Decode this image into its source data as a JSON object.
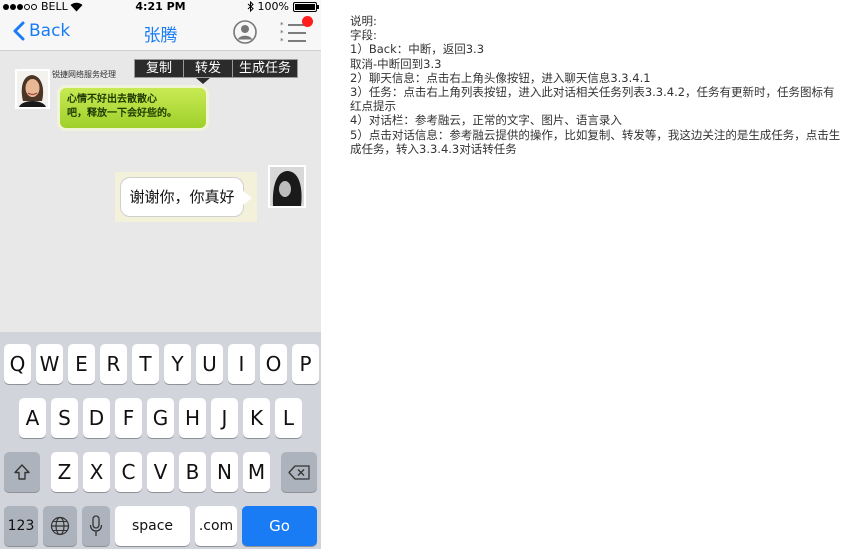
{
  "status_bar": {
    "carrier": "BELL",
    "time": "4:21 PM",
    "battery": "100%",
    "battery_level": 1.0
  },
  "nav": {
    "back_label": "Back",
    "title": "张腾",
    "tasks_has_update": true
  },
  "chat": {
    "context_menu": [
      "复制",
      "转发",
      "生成任务"
    ],
    "messages": [
      {
        "side": "left",
        "sender": "锐捷网络服务经理",
        "text_lines": [
          "心情不好出去散散心",
          "吧，释放一下会好些的。"
        ]
      },
      {
        "side": "right",
        "text": "谢谢你，你真好"
      }
    ]
  },
  "keyboard": {
    "row1": [
      "Q",
      "W",
      "E",
      "R",
      "T",
      "Y",
      "U",
      "I",
      "O",
      "P"
    ],
    "row2": [
      "A",
      "S",
      "D",
      "F",
      "G",
      "H",
      "J",
      "K",
      "L"
    ],
    "row3": [
      "Z",
      "X",
      "C",
      "V",
      "B",
      "N",
      "M"
    ],
    "numbers_key": "123",
    "space_key": "space",
    "dotcom_key": ".com",
    "go_key": "Go"
  },
  "notes": [
    "说明:",
    "字段:",
    "1）Back：中断，返回3.3",
    "取消-中断回到3.3",
    "2）聊天信息：点击右上角头像按钮，进入聊天信息3.3.4.1",
    "3）任务：点击右上角列表按钮，进入此对话相关任务列表3.3.4.2，任务有更新时，任务图标有红点提示",
    "4）对话栏：参考融云，正常的文字、图片、语言录入",
    "5）点击对话信息：参考融云提供的操作，比如复制、转发等，我这边关注的是生成任务，点击生成任务，转入3.3.4.3对话转任务"
  ],
  "colors": {
    "accent": "#1a7cf5",
    "badge": "#ff1d1d",
    "bubble_green": "#b5de3f"
  }
}
